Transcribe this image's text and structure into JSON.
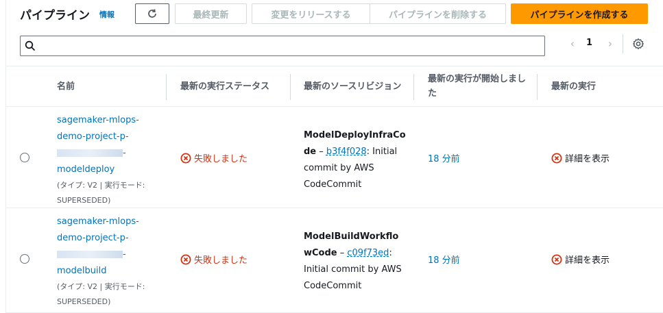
{
  "header": {
    "title": "パイプライン",
    "info_link": "情報",
    "buttons": {
      "refresh_icon": "refresh-icon",
      "latest_update": "最終更新",
      "release_change": "変更をリリースする",
      "delete_pipeline": "パイプラインを削除する",
      "create_pipeline": "パイプラインを作成する"
    },
    "search": {
      "placeholder": "",
      "value": ""
    },
    "pager": {
      "page": "1"
    }
  },
  "columns": {
    "name": "名前",
    "status": "最新の実行ステータス",
    "source_revision": "最新のソースリビジョン",
    "started": "最新の実行が開始しました",
    "latest_execution": "最新の実行"
  },
  "rows": [
    {
      "name_line1": "sagemaker-mlops-",
      "name_line2": "demo-project-p-",
      "name_line3_suffix": "-",
      "name_line4": "modeldeploy",
      "meta_line1": "(タイプ: V2 | 実行モード:",
      "meta_line2": "SUPERSEDED)",
      "status": "失敗しました",
      "revision_title": "ModelDeployInfraCode",
      "revision_dash": " – ",
      "revision_id": "b3f4f028",
      "revision_message": ": Initial commit by AWS CodeCommit",
      "started": "18 分前",
      "detail": "詳細を表示"
    },
    {
      "name_line1": "sagemaker-mlops-",
      "name_line2": "demo-project-p-",
      "name_line3_suffix": "-",
      "name_line4": "modelbuild",
      "meta_line1": "(タイプ: V2 | 実行モード:",
      "meta_line2": "SUPERSEDED)",
      "status": "失敗しました",
      "revision_title": "ModelBuildWorkflowCode",
      "revision_dash": " – ",
      "revision_id": "c09f73ed",
      "revision_message": ": Initial commit by AWS CodeCommit",
      "started": "18 分前",
      "detail": "詳細を表示"
    }
  ],
  "colors": {
    "link": "#0073bb",
    "error": "#d13212",
    "primary": "#ff9900"
  }
}
